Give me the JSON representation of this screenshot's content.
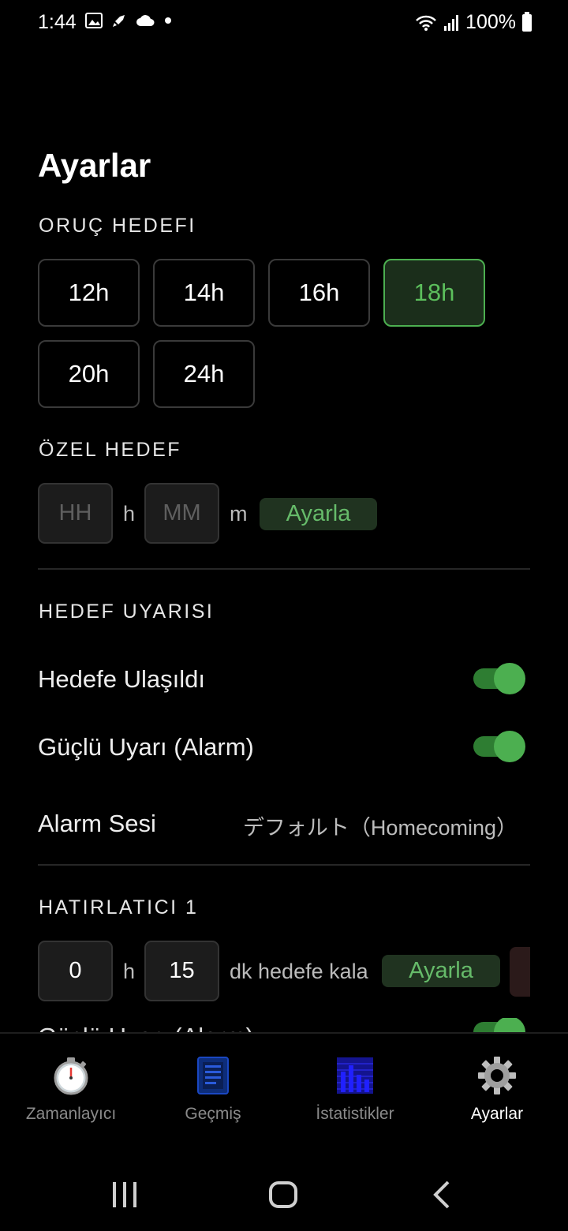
{
  "status_bar": {
    "time": "1:44",
    "battery": "100%"
  },
  "page": {
    "title": "Ayarlar"
  },
  "fasting_goal": {
    "section_title": "ORUÇ HEDEFI",
    "options": [
      {
        "label": "12h",
        "selected": false
      },
      {
        "label": "14h",
        "selected": false
      },
      {
        "label": "16h",
        "selected": false
      },
      {
        "label": "18h",
        "selected": true
      },
      {
        "label": "20h",
        "selected": false
      },
      {
        "label": "24h",
        "selected": false
      }
    ]
  },
  "custom_goal": {
    "section_title": "ÖZEL HEDEF",
    "hours_placeholder": "HH",
    "hours_unit": "h",
    "minutes_placeholder": "MM",
    "minutes_unit": "m",
    "set_label": "Ayarla"
  },
  "goal_alert": {
    "section_title": "HEDEF UYARISI",
    "goal_reached_label": "Hedefe Ulaşıldı",
    "goal_reached_on": true,
    "strong_alert_label": "Güçlü Uyarı (Alarm)",
    "strong_alert_on": true,
    "alarm_sound_label": "Alarm Sesi",
    "alarm_sound_value": "デフォルト（Homecoming）"
  },
  "reminder_1": {
    "section_title": "HATIRLATICI 1",
    "hours_value": "0",
    "hours_unit": "h",
    "minutes_value": "15",
    "suffix": "dk hedefe kala",
    "set_label": "Ayarla",
    "strong_alert_label": "Güçlü Uyarı (Alarm)",
    "strong_alert_on": true
  },
  "bottom_nav": {
    "items": [
      {
        "label": "Zamanlayıcı",
        "icon": "stopwatch-icon",
        "active": false
      },
      {
        "label": "Geçmiş",
        "icon": "history-document-icon",
        "active": false
      },
      {
        "label": "İstatistikler",
        "icon": "bar-chart-icon",
        "active": false
      },
      {
        "label": "Ayarlar",
        "icon": "gear-icon",
        "active": true
      }
    ]
  },
  "colors": {
    "accent": "#4caf50",
    "accent_text": "#66bb6a",
    "background": "#000000"
  }
}
